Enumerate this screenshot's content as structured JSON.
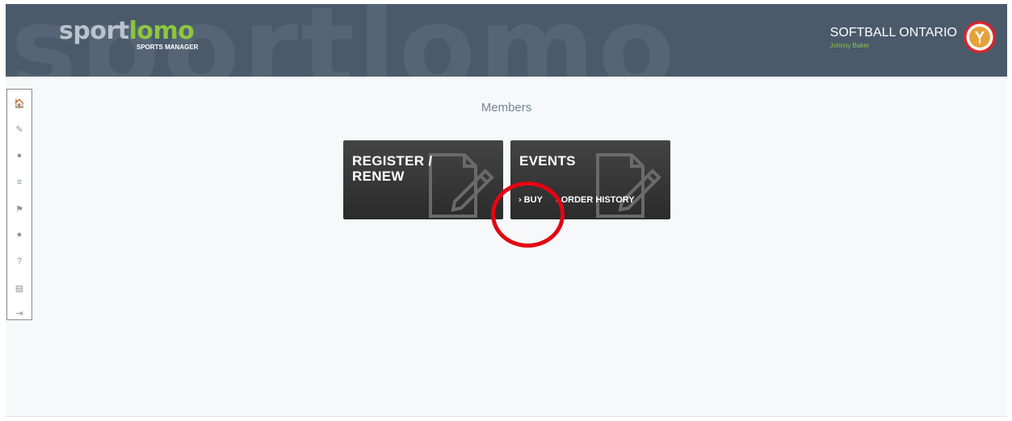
{
  "header": {
    "watermark": "sportlomo",
    "logo_part1": "sport",
    "logo_part2": "lomo",
    "logo_sub": "SPORTS MANAGER",
    "org_name": "SOFTBALL ONTARIO",
    "user_name": "Johnny Baker",
    "badge_icon": "softball-ontario-logo",
    "colors": {
      "header_bg": "#4a5a6b",
      "accent_green": "#8cc63f",
      "badge_red": "#d6262b"
    }
  },
  "sidebar": {
    "items": [
      {
        "name": "home",
        "glyph": "🏠",
        "icon": "home-icon"
      },
      {
        "name": "edit",
        "glyph": "✎",
        "icon": "edit-icon"
      },
      {
        "name": "profile",
        "glyph": "●",
        "icon": "user-icon"
      },
      {
        "name": "list",
        "glyph": "≡",
        "icon": "list-icon"
      },
      {
        "name": "flag",
        "glyph": "⚑",
        "icon": "flag-icon"
      },
      {
        "name": "account",
        "glyph": "●",
        "icon": "user-icon"
      },
      {
        "name": "help",
        "glyph": "?",
        "icon": "help-icon"
      },
      {
        "name": "documents",
        "glyph": "▤",
        "icon": "book-icon"
      },
      {
        "name": "logout",
        "glyph": "⇥",
        "icon": "logout-icon"
      }
    ]
  },
  "main": {
    "title": "Members",
    "tiles": [
      {
        "title_line1": "REGISTER /",
        "title_line2": "RENEW",
        "icon": "document-edit-icon"
      },
      {
        "title_line1": "EVENTS",
        "icon": "document-edit-icon",
        "links": [
          {
            "label": "BUY",
            "chevron": "›"
          },
          {
            "label": "ORDER HISTORY",
            "chevron": "›"
          }
        ]
      }
    ]
  },
  "annotation": {
    "highlight_color": "#e30613"
  }
}
